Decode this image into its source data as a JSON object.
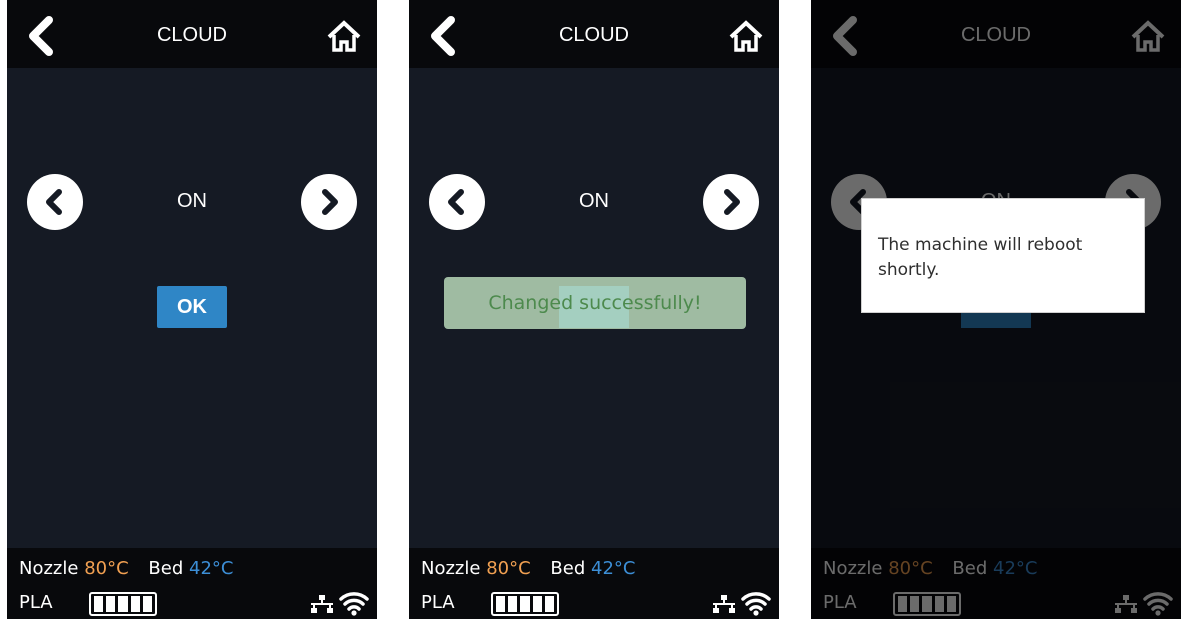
{
  "header": {
    "title": "CLOUD"
  },
  "setting": {
    "value": "ON",
    "ok_label": "OK"
  },
  "toast": {
    "message": "Changed successfully!"
  },
  "dialog": {
    "message": "The machine will reboot shortly."
  },
  "status": {
    "nozzle_label": "Nozzle",
    "nozzle_temp": "80°C",
    "bed_label": "Bed",
    "bed_temp": "42°C",
    "material": "PLA",
    "filament_level": 1.0
  },
  "icons": {
    "back": "back-icon",
    "home": "home-icon",
    "prev": "chevron-left-icon",
    "next": "chevron-right-icon",
    "network": "ethernet-icon",
    "wifi": "wifi-icon"
  },
  "colors": {
    "background": "#151a24",
    "bar": "#08090c",
    "accent": "#2f86c6",
    "nozzle": "#f1a052",
    "bed": "#3c8ed6",
    "toast_text": "#4d8a4d"
  },
  "screens": [
    "settings",
    "success-toast",
    "reboot-dialog"
  ]
}
